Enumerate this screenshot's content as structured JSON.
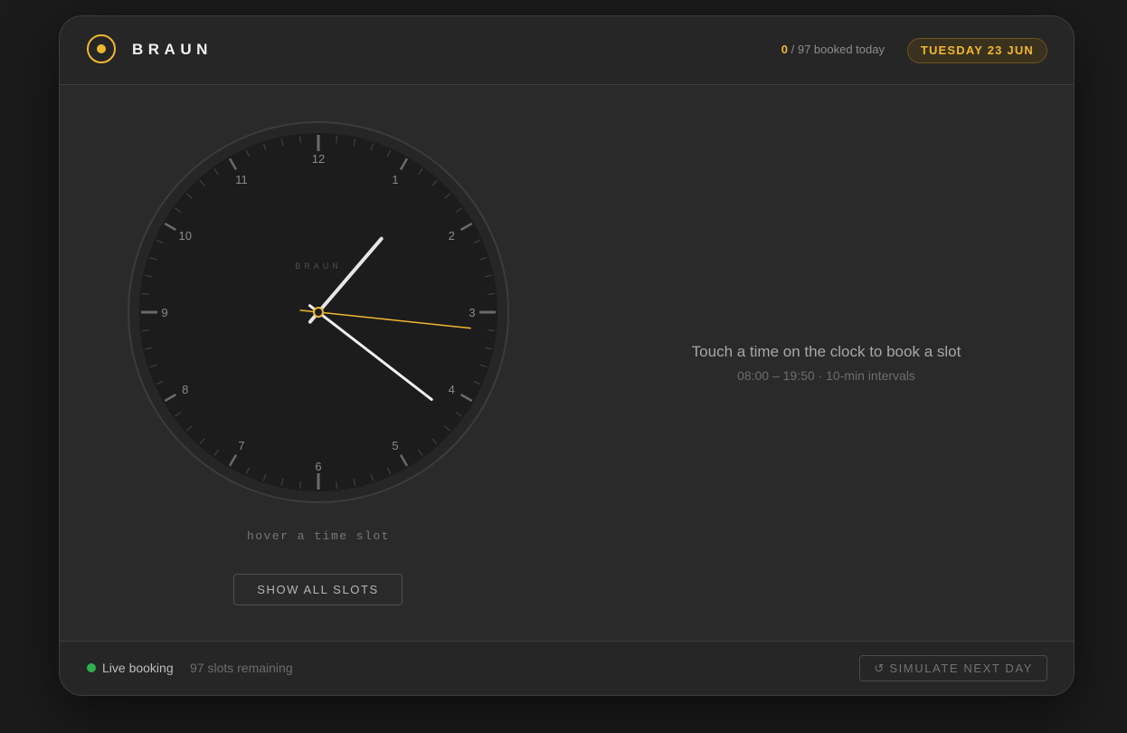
{
  "header": {
    "brand": "BRAUN",
    "booked_count": "0",
    "booked_suffix": " / 97 booked today",
    "date": "TUESDAY 23 JUN"
  },
  "clock": {
    "brand": "BRAUN",
    "numbers": [
      "12",
      "1",
      "2",
      "3",
      "4",
      "5",
      "6",
      "7",
      "8",
      "9",
      "10",
      "11"
    ],
    "time_shown": "01:21:16",
    "accent_color": "#f0b72f"
  },
  "hover_text": "hover a time slot",
  "show_all_label": "SHOW ALL SLOTS",
  "prompt": {
    "main": "Touch a time on the clock to book a slot",
    "sub": "08:00 – 19:50 · 10-min intervals"
  },
  "footer": {
    "live_label": "Live booking",
    "remaining": "97 slots remaining",
    "simulate_icon": "↺",
    "simulate_label": "SIMULATE NEXT DAY"
  },
  "colors": {
    "accent": "#f0b72f",
    "live": "#2fb24c",
    "background": "#1b1b1b",
    "panel": "#2a2a2a"
  }
}
